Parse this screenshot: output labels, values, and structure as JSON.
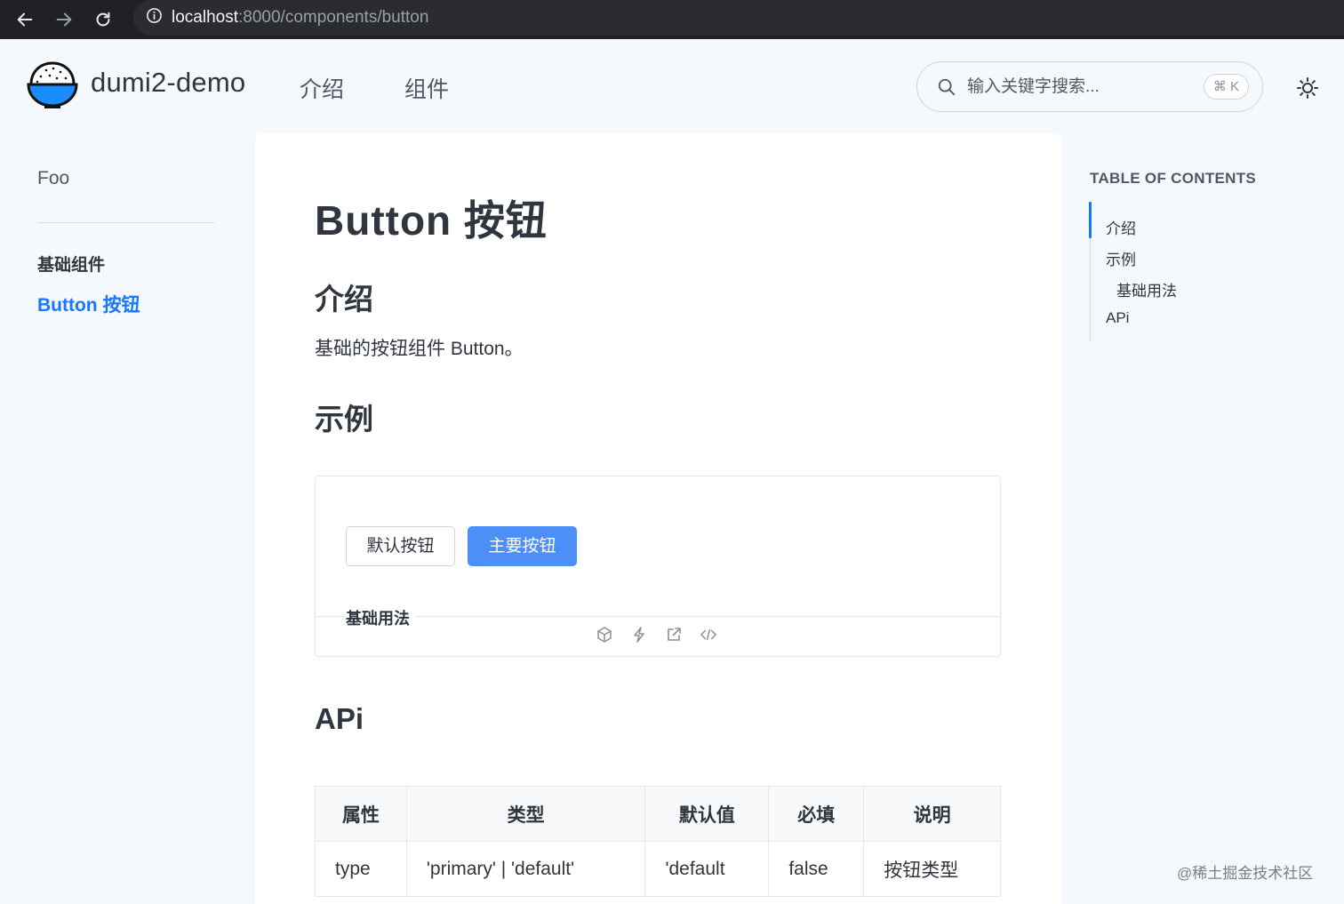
{
  "browser": {
    "url_host": "localhost",
    "url_path": ":8000/components/button"
  },
  "header": {
    "brand": "dumi2-demo",
    "nav": [
      "介绍",
      "组件"
    ],
    "search_placeholder": "输入关键字搜索...",
    "shortcut": "⌘ K"
  },
  "sidebar": {
    "top_item": "Foo",
    "group": "基础组件",
    "active_item": "Button 按钮"
  },
  "content": {
    "title": "Button 按钮",
    "intro_heading": "介绍",
    "intro_text": "基础的按钮组件 Button。",
    "example_heading": "示例",
    "demo": {
      "default_button": "默认按钮",
      "primary_button": "主要按钮",
      "title": "基础用法"
    },
    "api_heading": "APi",
    "table": {
      "headers": [
        "属性",
        "类型",
        "默认值",
        "必填",
        "说明"
      ],
      "rows": [
        [
          "type",
          "'primary' | 'default'",
          "'default",
          "false",
          "按钮类型"
        ]
      ]
    }
  },
  "toc": {
    "title": "TABLE OF CONTENTS",
    "items": [
      "介绍",
      "示例",
      "基础用法",
      "APi"
    ]
  },
  "watermark": "@稀土掘金技术社区",
  "colors": {
    "accent": "#1677ff",
    "primary_button": "#4c8ff7",
    "background": "#f5f8fc"
  }
}
